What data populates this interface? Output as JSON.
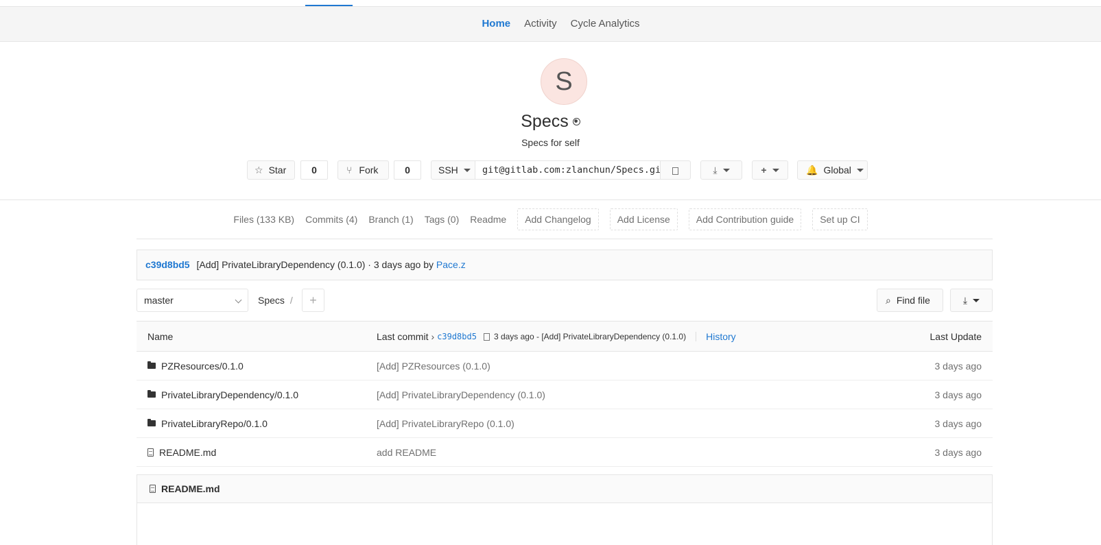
{
  "subnav": {
    "home": "Home",
    "activity": "Activity",
    "cycle": "Cycle Analytics"
  },
  "project": {
    "avatar_letter": "S",
    "name": "Specs",
    "description": "Specs for self"
  },
  "actions": {
    "star_label": "Star",
    "star_count": "0",
    "fork_label": "Fork",
    "fork_count": "0",
    "protocol": "SSH",
    "clone_url": "git@gitlab.com:zlanchun/Specs.git",
    "notify_label": "Global"
  },
  "stats": {
    "files": "Files (133 KB)",
    "commits": "Commits (4)",
    "branch": "Branch (1)",
    "tags": "Tags (0)",
    "readme": "Readme",
    "changelog": "Add Changelog",
    "license": "Add License",
    "contrib": "Add Contribution guide",
    "ci": "Set up CI"
  },
  "last_commit": {
    "sha": "c39d8bd5",
    "message": "[Add] PrivateLibraryDependency (0.1.0) · 3 days ago by",
    "author": "Pace.z"
  },
  "tree": {
    "branch": "master",
    "path": "Specs",
    "path_sep": "/",
    "plus": "+",
    "find_file": "Find file"
  },
  "table": {
    "headers": {
      "name": "Name",
      "last_commit": "Last commit",
      "sha": "c39d8bd5",
      "info": "3 days ago - [Add] PrivateLibraryDependency (0.1.0)",
      "history": "History",
      "last_update": "Last Update"
    },
    "rows": [
      {
        "name": "PZResources/0.1.0",
        "message": "[Add] PZResources (0.1.0)",
        "date": "3 days ago",
        "type": "folder"
      },
      {
        "name": "PrivateLibraryDependency/0.1.0",
        "message": "[Add] PrivateLibraryDependency (0.1.0)",
        "date": "3 days ago",
        "type": "folder"
      },
      {
        "name": "PrivateLibraryRepo/0.1.0",
        "message": "[Add] PrivateLibraryRepo (0.1.0)",
        "date": "3 days ago",
        "type": "folder"
      },
      {
        "name": "README.md",
        "message": "add README",
        "date": "3 days ago",
        "type": "file"
      }
    ]
  },
  "readme": {
    "title": "README.md"
  }
}
